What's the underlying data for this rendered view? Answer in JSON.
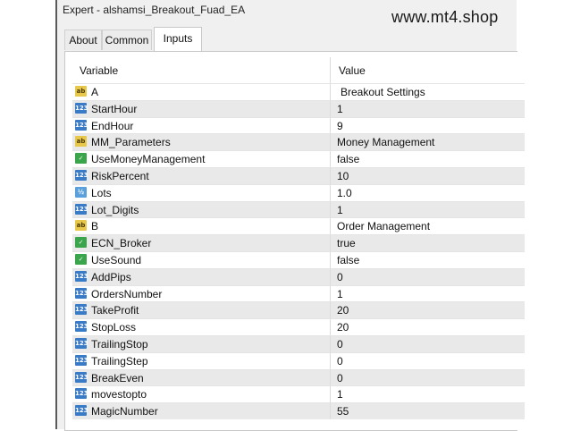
{
  "window": {
    "title": "Expert - alshamsi_Breakout_Fuad_EA",
    "watermark": "www.mt4.shop"
  },
  "tabs": [
    {
      "label": "About",
      "active": false
    },
    {
      "label": "Common",
      "active": false
    },
    {
      "label": "Inputs",
      "active": true
    }
  ],
  "table": {
    "columns": [
      "Variable",
      "Value"
    ],
    "rows": [
      {
        "icon": "string-icon",
        "name": "A",
        "value": "Breakout Settings"
      },
      {
        "icon": "integer-icon",
        "name": "StartHour",
        "value": "1"
      },
      {
        "icon": "integer-icon",
        "name": "EndHour",
        "value": "9"
      },
      {
        "icon": "string-icon",
        "name": "MM_Parameters",
        "value": "Money Management"
      },
      {
        "icon": "boolean-icon",
        "name": "UseMoneyManagement",
        "value": "false"
      },
      {
        "icon": "integer-icon",
        "name": "RiskPercent",
        "value": "10"
      },
      {
        "icon": "double-icon",
        "name": "Lots",
        "value": "1.0"
      },
      {
        "icon": "integer-icon",
        "name": "Lot_Digits",
        "value": "1"
      },
      {
        "icon": "string-icon",
        "name": "B",
        "value": "Order Management"
      },
      {
        "icon": "boolean-icon",
        "name": "ECN_Broker",
        "value": "true"
      },
      {
        "icon": "boolean-icon",
        "name": "UseSound",
        "value": "false"
      },
      {
        "icon": "integer-icon",
        "name": "AddPips",
        "value": "0"
      },
      {
        "icon": "integer-icon",
        "name": "OrdersNumber",
        "value": "1"
      },
      {
        "icon": "integer-icon",
        "name": "TakeProfit",
        "value": "20"
      },
      {
        "icon": "integer-icon",
        "name": "StopLoss",
        "value": "20"
      },
      {
        "icon": "integer-icon",
        "name": "TrailingStop",
        "value": "0"
      },
      {
        "icon": "integer-icon",
        "name": "TrailingStep",
        "value": "0"
      },
      {
        "icon": "integer-icon",
        "name": "BreakEven",
        "value": "0"
      },
      {
        "icon": "integer-icon",
        "name": "movestopto",
        "value": "1"
      },
      {
        "icon": "integer-icon",
        "name": "MagicNumber",
        "value": "55"
      }
    ]
  },
  "colors": {
    "window_bg": "#f0f0f0",
    "row_alt": "#e9e9e9",
    "int_icon": "#3a7bc8",
    "string_icon": "#e8c84a",
    "bool_icon": "#3aa54a"
  }
}
